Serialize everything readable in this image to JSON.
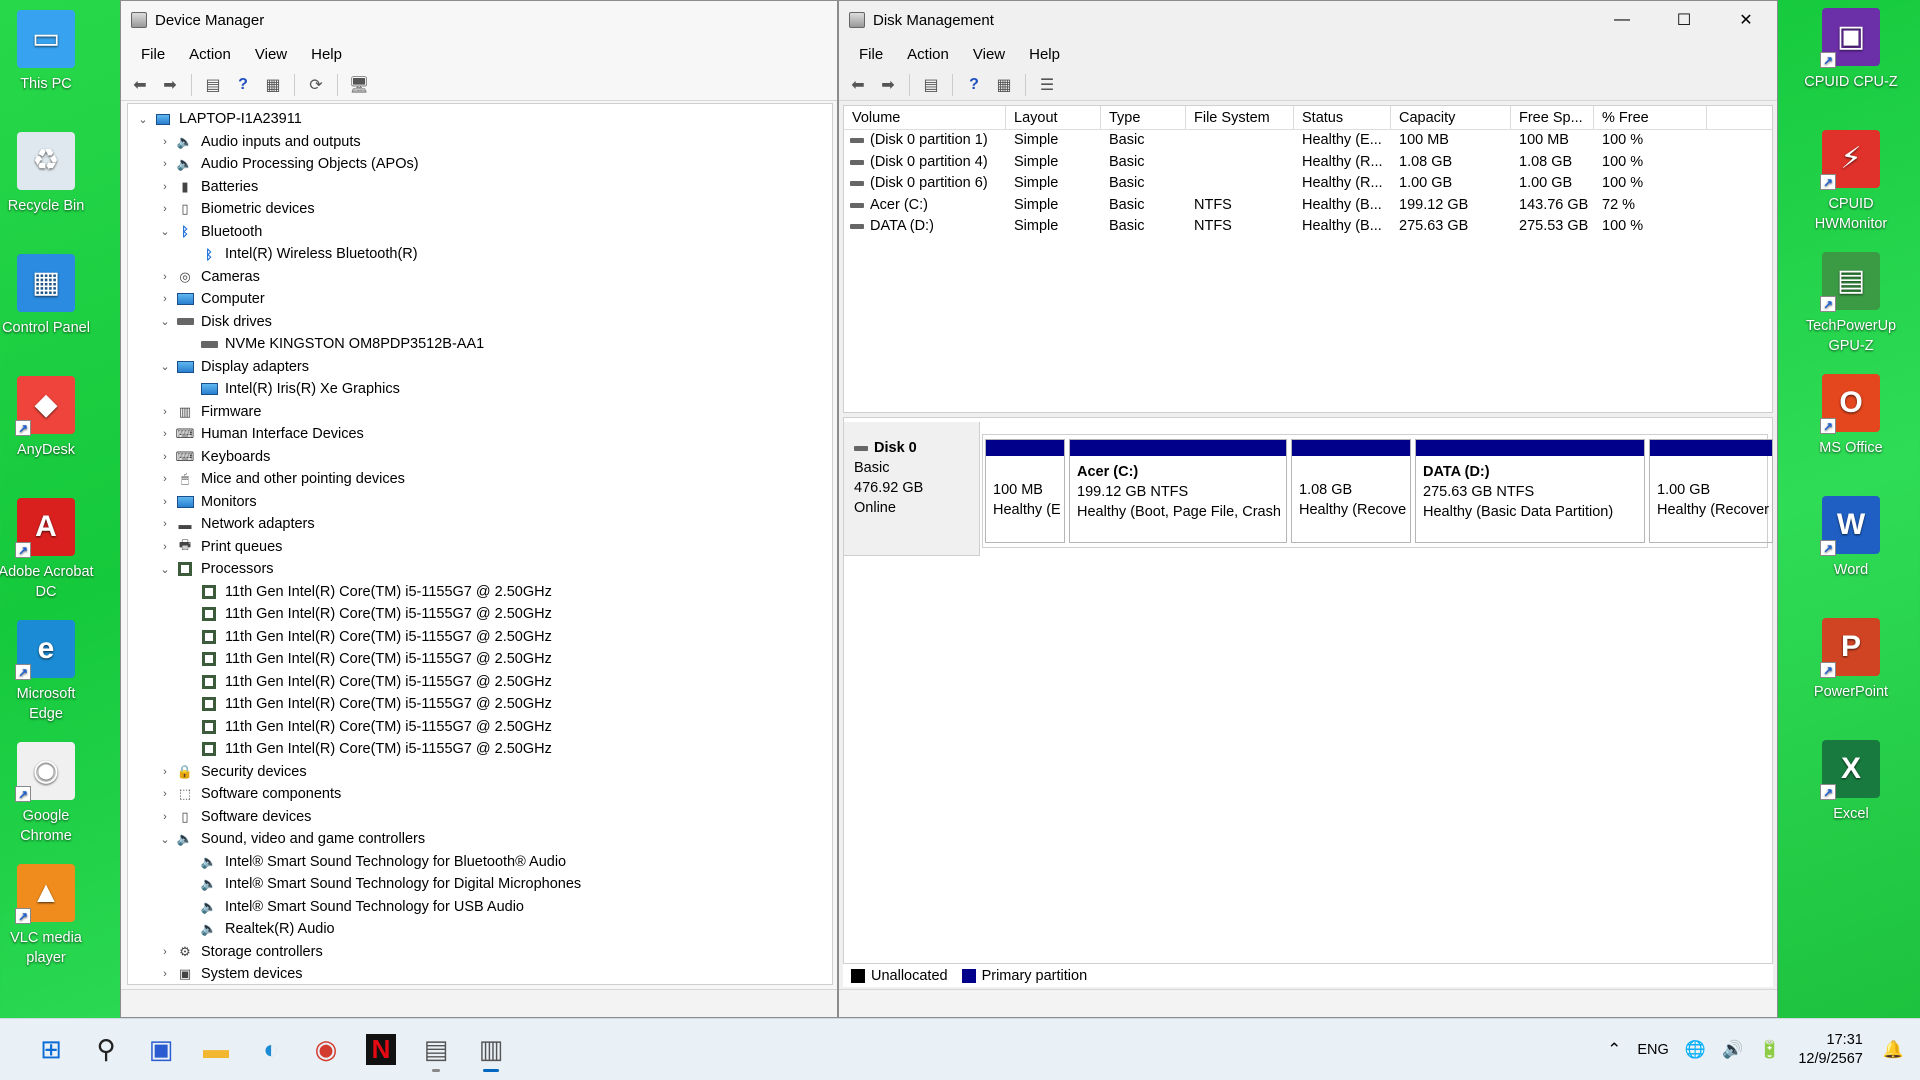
{
  "desktop": {
    "left_icons": [
      {
        "label": "This PC",
        "icon": "this-pc-icon"
      },
      {
        "label": "Recycle Bin",
        "icon": "recycle-bin-icon"
      },
      {
        "label": "Control Panel",
        "icon": "control-panel-icon"
      },
      {
        "label": "AnyDesk",
        "icon": "anydesk-icon"
      },
      {
        "label": "Adobe Acrobat DC",
        "icon": "acrobat-icon"
      },
      {
        "label": "Microsoft Edge",
        "icon": "edge-icon"
      },
      {
        "label": "Google Chrome",
        "icon": "chrome-icon"
      },
      {
        "label": "VLC media player",
        "icon": "vlc-icon"
      }
    ],
    "right_icons": [
      {
        "label": "CPUID CPU-Z",
        "icon": "cpuz-icon"
      },
      {
        "label": "CPUID HWMonitor",
        "icon": "hwmonitor-icon"
      },
      {
        "label": "TechPowerUp GPU-Z",
        "icon": "gpuz-icon"
      },
      {
        "label": "MS Office",
        "icon": "office-icon"
      },
      {
        "label": "Word",
        "icon": "word-icon"
      },
      {
        "label": "PowerPoint",
        "icon": "powerpoint-icon"
      },
      {
        "label": "Excel",
        "icon": "excel-icon"
      }
    ]
  },
  "device_manager": {
    "title": "Device Manager",
    "menu": [
      "File",
      "Action",
      "View",
      "Help"
    ],
    "root": "LAPTOP-I1A23911",
    "tree": [
      {
        "level": 1,
        "label": "Audio inputs and outputs",
        "state": "collapsed",
        "icon": "speaker-icon"
      },
      {
        "level": 1,
        "label": "Audio Processing Objects (APOs)",
        "state": "collapsed",
        "icon": "speaker-icon"
      },
      {
        "level": 1,
        "label": "Batteries",
        "state": "collapsed",
        "icon": "battery-icon"
      },
      {
        "level": 1,
        "label": "Biometric devices",
        "state": "collapsed",
        "icon": "biometric-icon"
      },
      {
        "level": 1,
        "label": "Bluetooth",
        "state": "expanded",
        "icon": "bluetooth-icon"
      },
      {
        "level": 2,
        "label": "Intel(R) Wireless Bluetooth(R)",
        "icon": "bluetooth-icon"
      },
      {
        "level": 1,
        "label": "Cameras",
        "state": "collapsed",
        "icon": "camera-icon"
      },
      {
        "level": 1,
        "label": "Computer",
        "state": "collapsed",
        "icon": "computer-icon"
      },
      {
        "level": 1,
        "label": "Disk drives",
        "state": "expanded",
        "icon": "disk-drive-icon"
      },
      {
        "level": 2,
        "label": "NVMe KINGSTON OM8PDP3512B-AA1",
        "icon": "disk-drive-icon"
      },
      {
        "level": 1,
        "label": "Display adapters",
        "state": "expanded",
        "icon": "display-adapter-icon"
      },
      {
        "level": 2,
        "label": "Intel(R) Iris(R) Xe Graphics",
        "icon": "display-adapter-icon"
      },
      {
        "level": 1,
        "label": "Firmware",
        "state": "collapsed",
        "icon": "firmware-icon"
      },
      {
        "level": 1,
        "label": "Human Interface Devices",
        "state": "collapsed",
        "icon": "hid-icon"
      },
      {
        "level": 1,
        "label": "Keyboards",
        "state": "collapsed",
        "icon": "keyboard-icon"
      },
      {
        "level": 1,
        "label": "Mice and other pointing devices",
        "state": "collapsed",
        "icon": "mouse-icon"
      },
      {
        "level": 1,
        "label": "Monitors",
        "state": "collapsed",
        "icon": "monitor-icon"
      },
      {
        "level": 1,
        "label": "Network adapters",
        "state": "collapsed",
        "icon": "network-icon"
      },
      {
        "level": 1,
        "label": "Print queues",
        "state": "collapsed",
        "icon": "printer-icon"
      },
      {
        "level": 1,
        "label": "Processors",
        "state": "expanded",
        "icon": "processor-icon"
      },
      {
        "level": 2,
        "label": "11th Gen Intel(R) Core(TM) i5-1155G7 @ 2.50GHz",
        "icon": "processor-icon"
      },
      {
        "level": 2,
        "label": "11th Gen Intel(R) Core(TM) i5-1155G7 @ 2.50GHz",
        "icon": "processor-icon"
      },
      {
        "level": 2,
        "label": "11th Gen Intel(R) Core(TM) i5-1155G7 @ 2.50GHz",
        "icon": "processor-icon"
      },
      {
        "level": 2,
        "label": "11th Gen Intel(R) Core(TM) i5-1155G7 @ 2.50GHz",
        "icon": "processor-icon"
      },
      {
        "level": 2,
        "label": "11th Gen Intel(R) Core(TM) i5-1155G7 @ 2.50GHz",
        "icon": "processor-icon"
      },
      {
        "level": 2,
        "label": "11th Gen Intel(R) Core(TM) i5-1155G7 @ 2.50GHz",
        "icon": "processor-icon"
      },
      {
        "level": 2,
        "label": "11th Gen Intel(R) Core(TM) i5-1155G7 @ 2.50GHz",
        "icon": "processor-icon"
      },
      {
        "level": 2,
        "label": "11th Gen Intel(R) Core(TM) i5-1155G7 @ 2.50GHz",
        "icon": "processor-icon"
      },
      {
        "level": 1,
        "label": "Security devices",
        "state": "collapsed",
        "icon": "security-icon"
      },
      {
        "level": 1,
        "label": "Software components",
        "state": "collapsed",
        "icon": "software-component-icon"
      },
      {
        "level": 1,
        "label": "Software devices",
        "state": "collapsed",
        "icon": "software-device-icon"
      },
      {
        "level": 1,
        "label": "Sound, video and game controllers",
        "state": "expanded",
        "icon": "speaker-icon"
      },
      {
        "level": 2,
        "label": "Intel® Smart Sound Technology for Bluetooth® Audio",
        "icon": "speaker-icon"
      },
      {
        "level": 2,
        "label": "Intel® Smart Sound Technology for Digital Microphones",
        "icon": "speaker-icon"
      },
      {
        "level": 2,
        "label": "Intel® Smart Sound Technology for USB Audio",
        "icon": "speaker-icon"
      },
      {
        "level": 2,
        "label": "Realtek(R) Audio",
        "icon": "speaker-icon"
      },
      {
        "level": 1,
        "label": "Storage controllers",
        "state": "collapsed",
        "icon": "storage-controller-icon"
      },
      {
        "level": 1,
        "label": "System devices",
        "state": "collapsed",
        "icon": "system-device-icon"
      }
    ]
  },
  "disk_management": {
    "title": "Disk Management",
    "menu": [
      "File",
      "Action",
      "View",
      "Help"
    ],
    "columns": [
      "Volume",
      "Layout",
      "Type",
      "File System",
      "Status",
      "Capacity",
      "Free Sp...",
      "% Free"
    ],
    "volumes": [
      [
        "(Disk 0 partition 1)",
        "Simple",
        "Basic",
        "",
        "Healthy (E...",
        "100 MB",
        "100 MB",
        "100 %"
      ],
      [
        "(Disk 0 partition 4)",
        "Simple",
        "Basic",
        "",
        "Healthy (R...",
        "1.08 GB",
        "1.08 GB",
        "100 %"
      ],
      [
        "(Disk 0 partition 6)",
        "Simple",
        "Basic",
        "",
        "Healthy (R...",
        "1.00 GB",
        "1.00 GB",
        "100 %"
      ],
      [
        "Acer (C:)",
        "Simple",
        "Basic",
        "NTFS",
        "Healthy (B...",
        "199.12 GB",
        "143.76 GB",
        "72 %"
      ],
      [
        "DATA (D:)",
        "Simple",
        "Basic",
        "NTFS",
        "Healthy (B...",
        "275.63 GB",
        "275.53 GB",
        "100 %"
      ]
    ],
    "disk": {
      "name": "Disk 0",
      "type": "Basic",
      "size": "476.92 GB",
      "status": "Online"
    },
    "partitions": [
      {
        "name": "",
        "size": "100 MB",
        "status": "Healthy (E"
      },
      {
        "name": "Acer  (C:)",
        "size": "199.12 GB NTFS",
        "status": "Healthy (Boot, Page File, Crash"
      },
      {
        "name": "",
        "size": "1.08 GB",
        "status": "Healthy (Recove"
      },
      {
        "name": "DATA  (D:)",
        "size": "275.63 GB NTFS",
        "status": "Healthy (Basic Data Partition)"
      },
      {
        "name": "",
        "size": "1.00 GB",
        "status": "Healthy (Recover"
      }
    ],
    "legend": [
      {
        "label": "Unallocated",
        "color": "#000000"
      },
      {
        "label": "Primary partition",
        "color": "#00008a"
      }
    ]
  },
  "taskbar": {
    "apps": [
      {
        "name": "start-button",
        "icon": "windows-logo-icon"
      },
      {
        "name": "search-button",
        "icon": "search-icon"
      },
      {
        "name": "store-button",
        "icon": "store-icon"
      },
      {
        "name": "file-explorer-button",
        "icon": "folder-icon"
      },
      {
        "name": "edge-taskbar-button",
        "icon": "edge-icon"
      },
      {
        "name": "chrome-taskbar-button",
        "icon": "chrome-icon"
      },
      {
        "name": "netflix-taskbar-button",
        "icon": "netflix-icon"
      },
      {
        "name": "device-manager-taskbar-button",
        "icon": "device-manager-icon"
      },
      {
        "name": "disk-management-taskbar-button",
        "icon": "disk-management-icon"
      }
    ],
    "language": "ENG",
    "time": "17:31",
    "date": "12/9/2567"
  }
}
